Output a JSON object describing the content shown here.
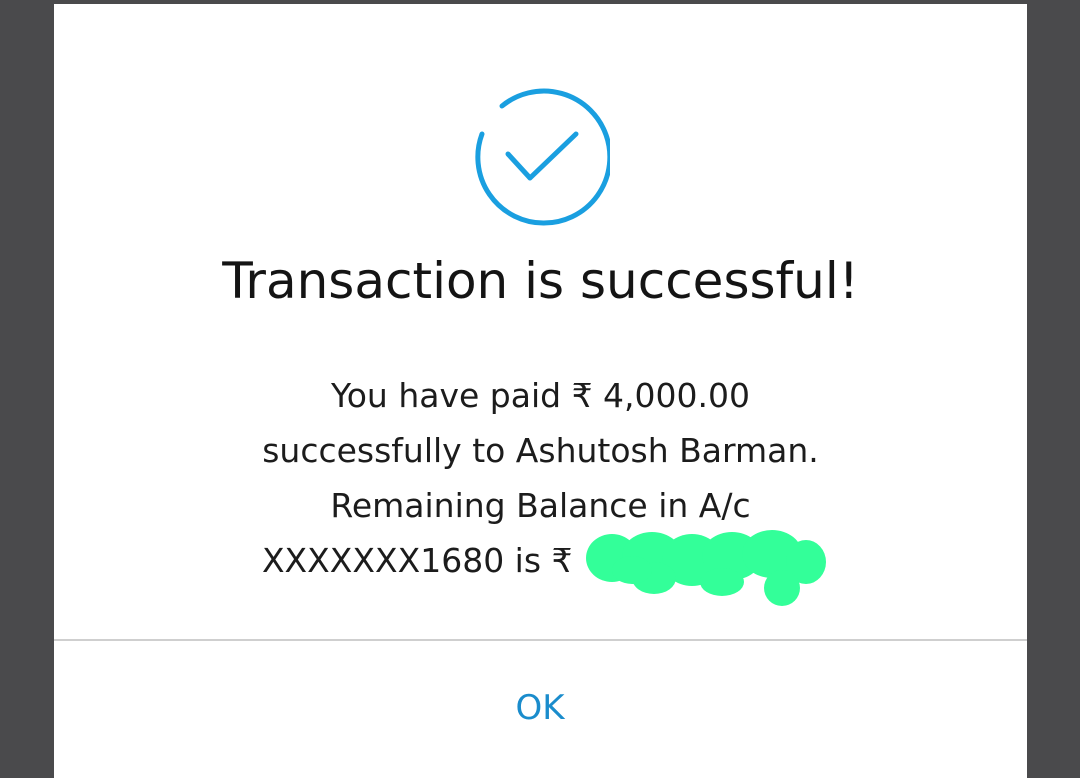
{
  "dialog": {
    "title": "Transaction is successful!",
    "message_lines": [
      "You have paid ₹ 4,000.00",
      "successfully to Ashutosh Barman.",
      "Remaining Balance in A/c",
      "XXXXXXX1680 is ₹"
    ],
    "message_trailing": ".",
    "ok_label": "OK"
  },
  "icons": {
    "status": "check-circle-icon"
  },
  "colors": {
    "accent": "#1a9fe0",
    "button_text": "#1a8ccc",
    "redaction": "#33ff99",
    "backdrop": "#4a4a4c"
  }
}
